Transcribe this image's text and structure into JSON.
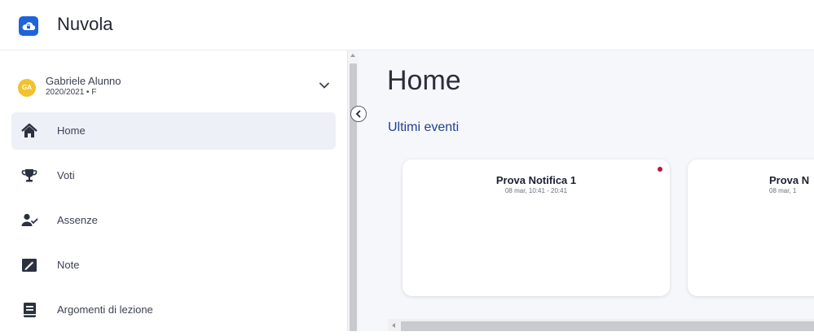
{
  "app": {
    "title": "Nuvola",
    "logo_icon": "cloud-lock-icon",
    "brand_color": "#1f63d8"
  },
  "user": {
    "name": "Gabriele Alunno",
    "year": "2020/2021 • F",
    "initials": "GA",
    "avatar_color": "#f2c12e"
  },
  "sidebar": {
    "items": [
      {
        "label": "Home",
        "icon": "home-icon",
        "active": true
      },
      {
        "label": "Voti",
        "icon": "trophy-icon",
        "active": false
      },
      {
        "label": "Assenze",
        "icon": "user-check-icon",
        "active": false
      },
      {
        "label": "Note",
        "icon": "note-icon",
        "active": false
      },
      {
        "label": "Argomenti di lezione",
        "icon": "book-icon",
        "active": false
      }
    ]
  },
  "main": {
    "page_title": "Home",
    "section_title": "Ultimi eventi",
    "events": [
      {
        "title": "Prova Notifica 1",
        "time": "08 mar, 10:41 - 20:41",
        "unread": true
      },
      {
        "title": "Prova N",
        "time": "08 mar, 1"
      }
    ]
  },
  "colors": {
    "accent": "#1f3f9c",
    "unread_dot": "#c0143c",
    "active_bg": "#eef0f7"
  }
}
